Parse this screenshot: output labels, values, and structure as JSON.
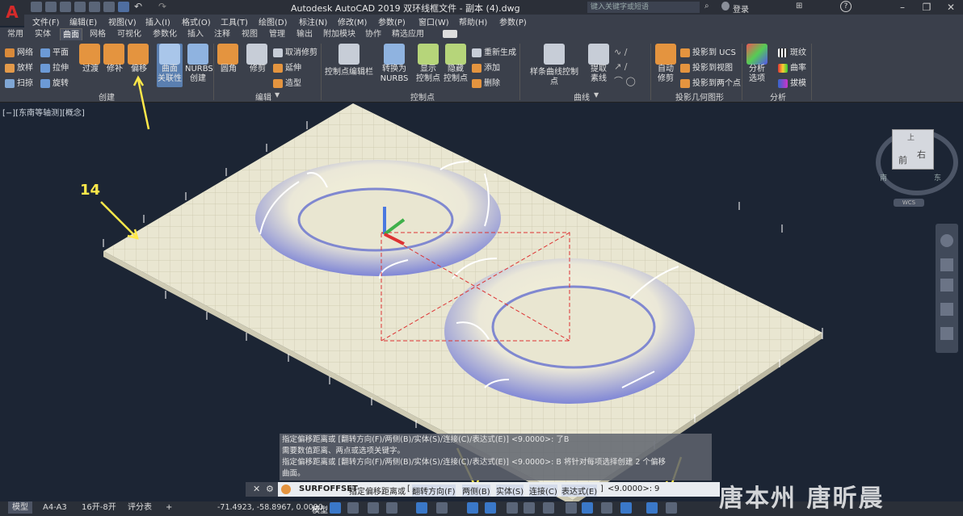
{
  "title_bar": {
    "app_letter": "A",
    "title": "Autodesk AutoCAD 2019    双环线框文件 - 副本 (4).dwg",
    "search_placeholder": "键入关键字或短语",
    "login": "登录",
    "help": "?"
  },
  "menu": [
    "文件(F)",
    "编辑(E)",
    "视图(V)",
    "插入(I)",
    "格式(O)",
    "工具(T)",
    "绘图(D)",
    "标注(N)",
    "修改(M)",
    "参数(P)",
    "窗口(W)",
    "帮助(H)",
    "参数(P)"
  ],
  "ribbon_tabs": [
    "常用",
    "实体",
    "曲面",
    "网格",
    "可视化",
    "参数化",
    "插入",
    "注释",
    "视图",
    "管理",
    "输出",
    "附加模块",
    "协作",
    "精选应用"
  ],
  "active_tab": "曲面",
  "ribbon": {
    "create_small": [
      "网络",
      "放样",
      "扫掠",
      "平面",
      "拉伸",
      "旋转"
    ],
    "create_big": [
      "过渡",
      "修补",
      "偏移",
      "曲面\n关联性",
      "NURBS\n创建"
    ],
    "create_group": "创建",
    "edit_big": [
      "圆角",
      "修剪"
    ],
    "edit_small": [
      "取消修剪",
      "延伸",
      "造型"
    ],
    "edit_group": "编辑",
    "cp_big": [
      "控制点编辑栏",
      "转换为\nNURBS",
      "显示\n控制点",
      "隐藏\n控制点"
    ],
    "cp_small": [
      "重新生成",
      "添加",
      "删除"
    ],
    "cp_group": "控制点",
    "curve_big": [
      "样条曲线控制点",
      "提取\n素线"
    ],
    "curve_group": "曲线",
    "proj_big": [
      "自动\n修剪"
    ],
    "proj_small": [
      "投影到 UCS",
      "投影到视图",
      "投影到两个点"
    ],
    "proj_group": "投影几何图形",
    "analysis_big": [
      "分析\n选项"
    ],
    "analysis_small": [
      "斑纹",
      "曲率",
      "拔模"
    ],
    "analysis_group": "分析"
  },
  "viewport": {
    "label": "[−][东南等轴测][概念]",
    "annotation_number": "14",
    "viewcube_top": "上",
    "viewcube_front": "前",
    "viewcube_right": "右",
    "compass_s": "南",
    "compass_e": "东",
    "wcs_label": "WCS"
  },
  "command_history": [
    "指定偏移距离或 [翻转方向(F)/两侧(B)/实体(S)/连接(C)/表达式(E)] <9.0000>: 了B",
    "需要数值距离、两点或选项关键字。",
    "指定偏移距离或 [翻转方向(F)/两侧(B)/实体(S)/连接(C)/表达式(E)] <9.0000>: B 将针对每项选择创建 2 个偏移",
    "曲面。"
  ],
  "command_line": {
    "command": "SURFOFFSET",
    "prompt": "指定偏移距离或",
    "options": [
      "翻转方向(F)",
      "两侧(B)",
      "实体(S)",
      "连接(C)",
      "表达式(E)"
    ],
    "default": "<9.0000>:",
    "input": "9"
  },
  "layout_tabs": [
    "模型",
    "A4-A3",
    "16开-8开",
    "评分表"
  ],
  "coordinates": "-71.4923, -58.8967, 0.0000",
  "model_label": "模型",
  "watermark": "唐本州 唐昕晨",
  "colors": {
    "accent": "#4a90d9",
    "annotation": "#ffe84a"
  }
}
